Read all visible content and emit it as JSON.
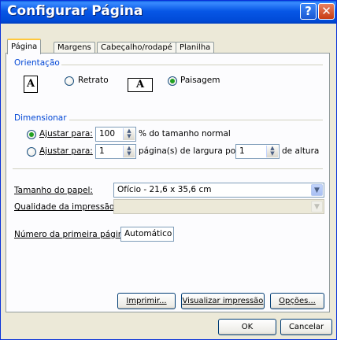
{
  "window": {
    "title": "Configurar Página",
    "help_glyph": "?",
    "close_glyph": "✕"
  },
  "tabs": [
    {
      "label": "Página",
      "active": true
    },
    {
      "label": "Margens",
      "active": false
    },
    {
      "label": "Cabeçalho/rodapé",
      "active": false
    },
    {
      "label": "Planilha",
      "active": false
    }
  ],
  "orientation": {
    "section_label": "Orientação",
    "portrait_label": "Retrato",
    "landscape_label": "Paisagem",
    "selected": "landscape",
    "icon_letter": "A"
  },
  "scaling": {
    "section_label": "Dimensionar",
    "adjust_label_1": "Ajustar para:",
    "percent_value": "100",
    "percent_suffix": "% do tamanho normal",
    "adjust_label_2": "Ajustar para:",
    "pages_wide_value": "1",
    "pages_wide_suffix": "página(s) de largura por",
    "pages_tall_value": "1",
    "pages_tall_suffix": "de altura",
    "selected": "percent"
  },
  "paper": {
    "paper_size_label": "Tamanho do papel:",
    "paper_size_value": "Ofício - 21,6 x 35,6 cm",
    "print_quality_label": "Qualidade da impressão:",
    "print_quality_value": "",
    "first_page_label": "Número da primeira página:",
    "first_page_value": "Automático"
  },
  "actions": {
    "print": "Imprimir...",
    "preview": "Visualizar impressão",
    "options": "Opções..."
  },
  "footer": {
    "ok": "OK",
    "cancel": "Cancelar"
  },
  "colors": {
    "titlebar": "#0054e3",
    "section_text": "#0046d5",
    "radio_selected": "#21a121",
    "dialog_bg": "#ece9d8"
  }
}
